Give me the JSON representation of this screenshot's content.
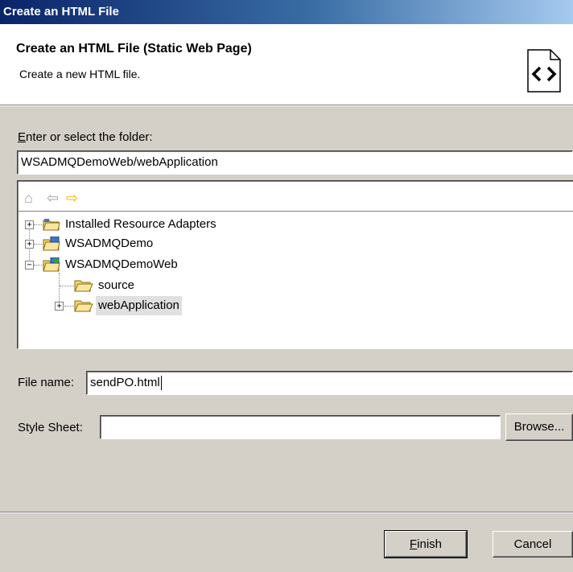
{
  "window": {
    "title": "Create an HTML File"
  },
  "banner": {
    "title": "Create an HTML File (Static Web Page)",
    "description": "Create a new HTML file.",
    "icon": "html-file-icon"
  },
  "folder": {
    "label_mnemonic": "E",
    "label_rest": "nter or select the folder:",
    "value": "WSADMQDemoWeb/webApplication"
  },
  "tree": {
    "toolbar": [
      "home-icon",
      "back-arrow-icon",
      "forward-arrow-icon"
    ],
    "nodes": [
      {
        "label": "Installed Resource Adapters",
        "expander": "+"
      },
      {
        "label": "WSADMQDemo",
        "expander": "+"
      },
      {
        "label": "WSADMQDemoWeb",
        "expander": "−"
      },
      {
        "label": "source"
      },
      {
        "label": "webApplication",
        "expander": "+",
        "selected": true
      }
    ]
  },
  "file_name": {
    "label": "File name:",
    "value": "sendPO.html"
  },
  "style_sheet": {
    "label": "Style Sheet:",
    "value": "",
    "browse_label": "Browse..."
  },
  "buttons": {
    "finish_mnemonic": "F",
    "finish_rest": "inish",
    "cancel_label": "Cancel"
  },
  "colors": {
    "title_bar": "#0a246a",
    "dialog_bg": "#d4d0c8",
    "selection": "#e0e0e0"
  }
}
